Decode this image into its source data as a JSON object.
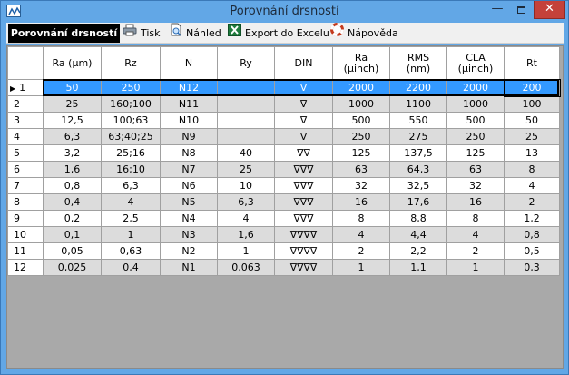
{
  "window": {
    "title": "Porovnání drsností",
    "minimize": "—",
    "close": "✕"
  },
  "toolbar": {
    "heading": "Porovnání drsností",
    "print": "Tisk",
    "preview": "Náhled",
    "export": "Export do Excelu",
    "help": "Nápověda"
  },
  "icons": {
    "print": "printer-icon",
    "preview": "preview-icon",
    "excel": "excel-icon",
    "help": "lifebuoy-icon"
  },
  "colors": {
    "selection": "#3399ff",
    "alt_row": "#dcdcdc",
    "titlebar": "#62a7e6",
    "close": "#c4413a"
  },
  "table": {
    "columns": [
      {
        "line1": "Ra (µm)",
        "line2": ""
      },
      {
        "line1": "Rz",
        "line2": ""
      },
      {
        "line1": "N",
        "line2": ""
      },
      {
        "line1": "Ry",
        "line2": ""
      },
      {
        "line1": "DIN",
        "line2": ""
      },
      {
        "line1": "Ra",
        "line2": "(µinch)"
      },
      {
        "line1": "RMS",
        "line2": "(nm)"
      },
      {
        "line1": "CLA",
        "line2": "(µinch)"
      },
      {
        "line1": "Rt",
        "line2": ""
      }
    ],
    "rows": [
      {
        "id": "1",
        "cells": [
          "50",
          "250",
          "N12",
          "",
          "∇",
          "2000",
          "2200",
          "2000",
          "200"
        ]
      },
      {
        "id": "2",
        "cells": [
          "25",
          "160;100",
          "N11",
          "",
          "∇",
          "1000",
          "1100",
          "1000",
          "100"
        ]
      },
      {
        "id": "3",
        "cells": [
          "12,5",
          "100;63",
          "N10",
          "",
          "∇",
          "500",
          "550",
          "500",
          "50"
        ]
      },
      {
        "id": "4",
        "cells": [
          "6,3",
          "63;40;25",
          "N9",
          "",
          "∇",
          "250",
          "275",
          "250",
          "25"
        ]
      },
      {
        "id": "5",
        "cells": [
          "3,2",
          "25;16",
          "N8",
          "40",
          "∇∇",
          "125",
          "137,5",
          "125",
          "13"
        ]
      },
      {
        "id": "6",
        "cells": [
          "1,6",
          "16;10",
          "N7",
          "25",
          "∇∇∇",
          "63",
          "64,3",
          "63",
          "8"
        ]
      },
      {
        "id": "7",
        "cells": [
          "0,8",
          "6,3",
          "N6",
          "10",
          "∇∇∇",
          "32",
          "32,5",
          "32",
          "4"
        ]
      },
      {
        "id": "8",
        "cells": [
          "0,4",
          "4",
          "N5",
          "6,3",
          "∇∇∇",
          "16",
          "17,6",
          "16",
          "2"
        ]
      },
      {
        "id": "9",
        "cells": [
          "0,2",
          "2,5",
          "N4",
          "4",
          "∇∇∇",
          "8",
          "8,8",
          "8",
          "1,2"
        ]
      },
      {
        "id": "10",
        "cells": [
          "0,1",
          "1",
          "N3",
          "1,6",
          "∇∇∇∇",
          "4",
          "4,4",
          "4",
          "0,8"
        ]
      },
      {
        "id": "11",
        "cells": [
          "0,05",
          "0,63",
          "N2",
          "1",
          "∇∇∇∇",
          "2",
          "2,2",
          "2",
          "0,5"
        ]
      },
      {
        "id": "12",
        "cells": [
          "0,025",
          "0,4",
          "N1",
          "0,063",
          "∇∇∇∇",
          "1",
          "1,1",
          "1",
          "0,3"
        ]
      }
    ],
    "selected_row": 0
  }
}
